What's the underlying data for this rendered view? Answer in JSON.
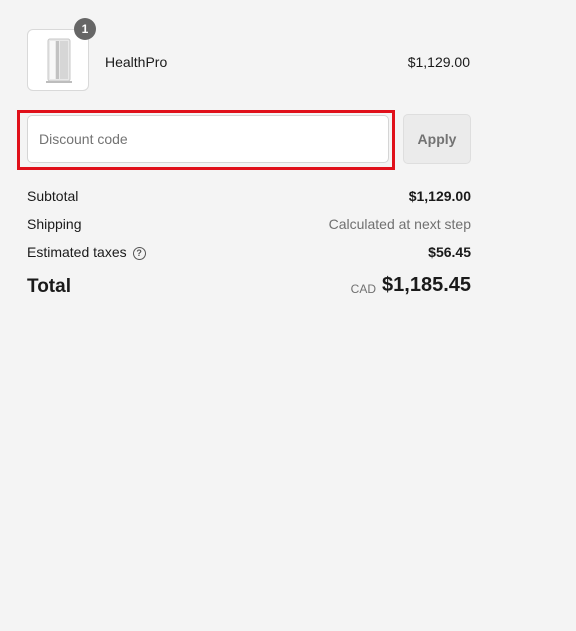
{
  "product": {
    "quantity": "1",
    "name": "HealthPro",
    "price": "$1,129.00",
    "image_icon": "air-purifier-image"
  },
  "discount": {
    "placeholder": "Discount code",
    "value": "",
    "apply_label": "Apply",
    "highlight_color": "#e0101a"
  },
  "summary": {
    "subtotal_label": "Subtotal",
    "subtotal_value": "$1,129.00",
    "shipping_label": "Shipping",
    "shipping_value": "Calculated at next step",
    "taxes_label": "Estimated taxes",
    "taxes_help_icon": "question-circle-icon",
    "taxes_value": "$56.45",
    "total_label": "Total",
    "total_currency": "CAD",
    "total_value": "$1,185.45"
  }
}
